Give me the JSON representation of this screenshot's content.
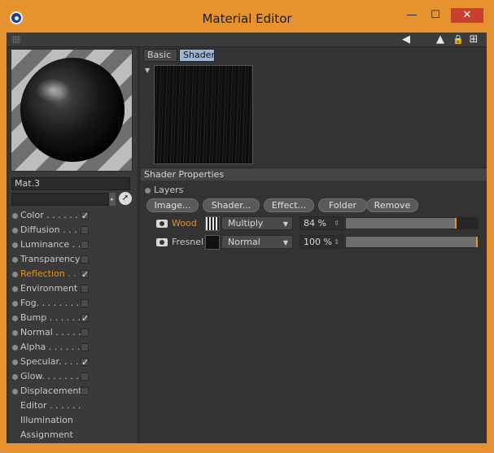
{
  "window": {
    "title": "Material Editor",
    "controls": {
      "minimize": "—",
      "maximize": "☐",
      "close": "✕"
    }
  },
  "toolbar": {
    "icons": [
      "arrow-left-icon",
      "arrow-up-icon",
      "lock-icon",
      "new-window-icon"
    ],
    "glyphs": {
      "back": "◀",
      "up": "▲",
      "lock": "🔒",
      "new": "⊞"
    }
  },
  "material": {
    "name": "Mat.3",
    "path": "",
    "path_button": "▸",
    "picker": "➚"
  },
  "channels": [
    {
      "label": "Color . . . . . .",
      "checked": true,
      "active": false,
      "has_dot": true,
      "has_checkbox": true
    },
    {
      "label": "Diffusion . . .",
      "checked": false,
      "active": false,
      "has_dot": true,
      "has_checkbox": true
    },
    {
      "label": "Luminance . .",
      "checked": false,
      "active": false,
      "has_dot": true,
      "has_checkbox": true
    },
    {
      "label": "Transparency",
      "checked": false,
      "active": false,
      "has_dot": true,
      "has_checkbox": true
    },
    {
      "label": "Reflection . .",
      "checked": true,
      "active": true,
      "has_dot": true,
      "has_checkbox": true
    },
    {
      "label": "Environment",
      "checked": false,
      "active": false,
      "has_dot": true,
      "has_checkbox": true
    },
    {
      "label": "Fog. . . . . . . .",
      "checked": false,
      "active": false,
      "has_dot": true,
      "has_checkbox": true
    },
    {
      "label": "Bump . . . . . .",
      "checked": true,
      "active": false,
      "has_dot": true,
      "has_checkbox": true
    },
    {
      "label": "Normal . . . . .",
      "checked": false,
      "active": false,
      "has_dot": true,
      "has_checkbox": true
    },
    {
      "label": "Alpha . . . . . .",
      "checked": false,
      "active": false,
      "has_dot": true,
      "has_checkbox": true
    },
    {
      "label": "Specular. . . .",
      "checked": true,
      "active": false,
      "has_dot": true,
      "has_checkbox": true
    },
    {
      "label": "Glow. . . . . . .",
      "checked": false,
      "active": false,
      "has_dot": true,
      "has_checkbox": true
    },
    {
      "label": "Displacement",
      "checked": false,
      "active": false,
      "has_dot": true,
      "has_checkbox": true
    },
    {
      "label": "Editor . . . . . .",
      "checked": false,
      "active": false,
      "has_dot": false,
      "has_checkbox": false
    },
    {
      "label": "Illumination",
      "checked": false,
      "active": false,
      "has_dot": false,
      "has_checkbox": false
    },
    {
      "label": "Assignment",
      "checked": false,
      "active": false,
      "has_dot": false,
      "has_checkbox": false
    }
  ],
  "checkmark": "✓",
  "tabs": [
    {
      "label": "Basic",
      "selected": false
    },
    {
      "label": "Shader",
      "selected": true
    }
  ],
  "texture": {
    "collapse_arrow": "▼"
  },
  "shader_properties": {
    "title": "Shader Properties",
    "layers_label": "Layers",
    "buttons": [
      "Image...",
      "Shader...",
      "Effect...",
      "Folder",
      "Remove"
    ],
    "layers": [
      {
        "name": "Wood",
        "active": true,
        "thumb": "wood",
        "mode": "Multiply",
        "percent": "84 %",
        "value": 0.84
      },
      {
        "name": "Fresnel",
        "active": false,
        "thumb": "fresnel",
        "mode": "Normal",
        "percent": "100 %",
        "value": 1.0
      }
    ],
    "dropdown_arrow": "▼",
    "spin_arrows": "⇕"
  },
  "colors": {
    "frame_orange": "#e6922e",
    "accent_orange": "#e8922a",
    "tab_selected": "#9db4d4",
    "close_red": "#c9412e"
  }
}
